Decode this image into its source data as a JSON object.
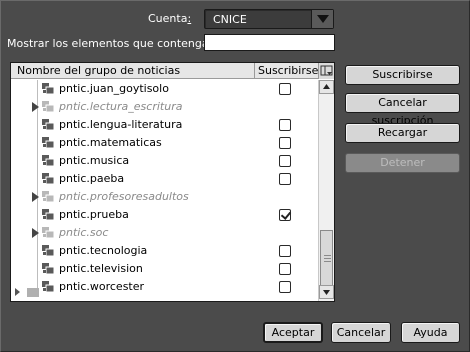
{
  "account": {
    "label_pre": "Cuenta",
    "label_colon": ":",
    "selected": "CNICE"
  },
  "filter": {
    "label": "Mostrar los elementos que contengan:",
    "value": ""
  },
  "list": {
    "columns": {
      "name": "Nombre del grupo de noticias",
      "subscribe": "Suscribirse"
    },
    "rows": [
      {
        "name": "pntic.juan_goytisolo",
        "type": "group",
        "checked": false
      },
      {
        "name": "pntic.lectura_escritura",
        "type": "folder",
        "checked": false
      },
      {
        "name": "pntic.lengua-literatura",
        "type": "group",
        "checked": false
      },
      {
        "name": "pntic.matematicas",
        "type": "group",
        "checked": false
      },
      {
        "name": "pntic.musica",
        "type": "group",
        "checked": false
      },
      {
        "name": "pntic.paeba",
        "type": "group",
        "checked": false
      },
      {
        "name": "pntic.profesoresadultos",
        "type": "folder",
        "checked": false
      },
      {
        "name": "pntic.prueba",
        "type": "group",
        "checked": true
      },
      {
        "name": "pntic.soc",
        "type": "folder",
        "checked": false
      },
      {
        "name": "pntic.tecnologia",
        "type": "group",
        "checked": false
      },
      {
        "name": "pntic.television",
        "type": "group",
        "checked": false
      },
      {
        "name": "pntic.worcester",
        "type": "group",
        "checked": false
      }
    ]
  },
  "side_buttons": {
    "subscribe": "Suscribirse",
    "unsubscribe": "Cancelar suscripción",
    "reload": "Recargar",
    "stop": "Detener"
  },
  "bottom_buttons": {
    "accept": "Aceptar",
    "cancel": "Cancelar",
    "help": "Ayuda"
  },
  "colors": {
    "background": "#4b4b4b",
    "button": "#d6d6d6",
    "folder_text": "#8a8a8a"
  }
}
